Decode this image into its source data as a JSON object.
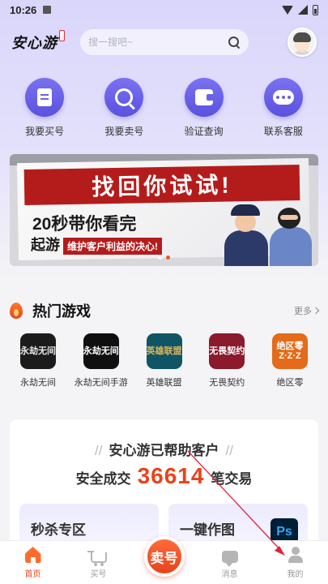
{
  "status_bar": {
    "time": "10:26"
  },
  "header": {
    "logo": "安心游",
    "search_placeholder": "搜一搜吧~"
  },
  "quick_actions": [
    {
      "label": "我要买号",
      "icon": "document-icon"
    },
    {
      "label": "我要卖号",
      "icon": "search-icon"
    },
    {
      "label": "验证查询",
      "icon": "wallet-icon"
    },
    {
      "label": "联系客服",
      "icon": "chat-icon"
    }
  ],
  "banner": {
    "headline": "找回你试试!",
    "line2": "20秒带你看完",
    "line3_prefix": "起游",
    "line3_slogan": "维护客户利益的决心!",
    "slide_count": 2,
    "active_slide": 2
  },
  "hot_games": {
    "title": "热门游戏",
    "more": "更多",
    "items": [
      {
        "name": "永劫无间",
        "icon_text": "永劫无间",
        "bg": "#1b1b1b",
        "fg": "#e9e9e9"
      },
      {
        "name": "永劫无间手游",
        "icon_text": "永劫无间",
        "bg": "#0f0f0f",
        "fg": "#ffffff"
      },
      {
        "name": "英雄联盟",
        "icon_text": "英雄联盟",
        "bg": "#0f5565",
        "fg": "#d9b65a"
      },
      {
        "name": "无畏契约",
        "icon_text": "无畏契约",
        "bg": "#8a1a2c",
        "fg": "#ffffff"
      },
      {
        "name": "绝区零",
        "icon_text": "绝区零 Z·Z·Z",
        "bg": "#e36b1a",
        "fg": "#ffffff"
      }
    ]
  },
  "stats": {
    "title": "安心游已帮助客户",
    "prefix": "安全成交",
    "count": "36614",
    "suffix": "笔交易",
    "promo_a": "秒杀专区",
    "promo_b": "一键作图",
    "ps_icon_text": "Ps"
  },
  "tabbar": {
    "home": "首页",
    "buy": "买号",
    "sell": "卖号",
    "messages": "消息",
    "mine": "我的"
  },
  "colors": {
    "accent_purple": "#6a62ea",
    "accent_orange": "#e8431c",
    "annotation_red": "#e0223a"
  }
}
